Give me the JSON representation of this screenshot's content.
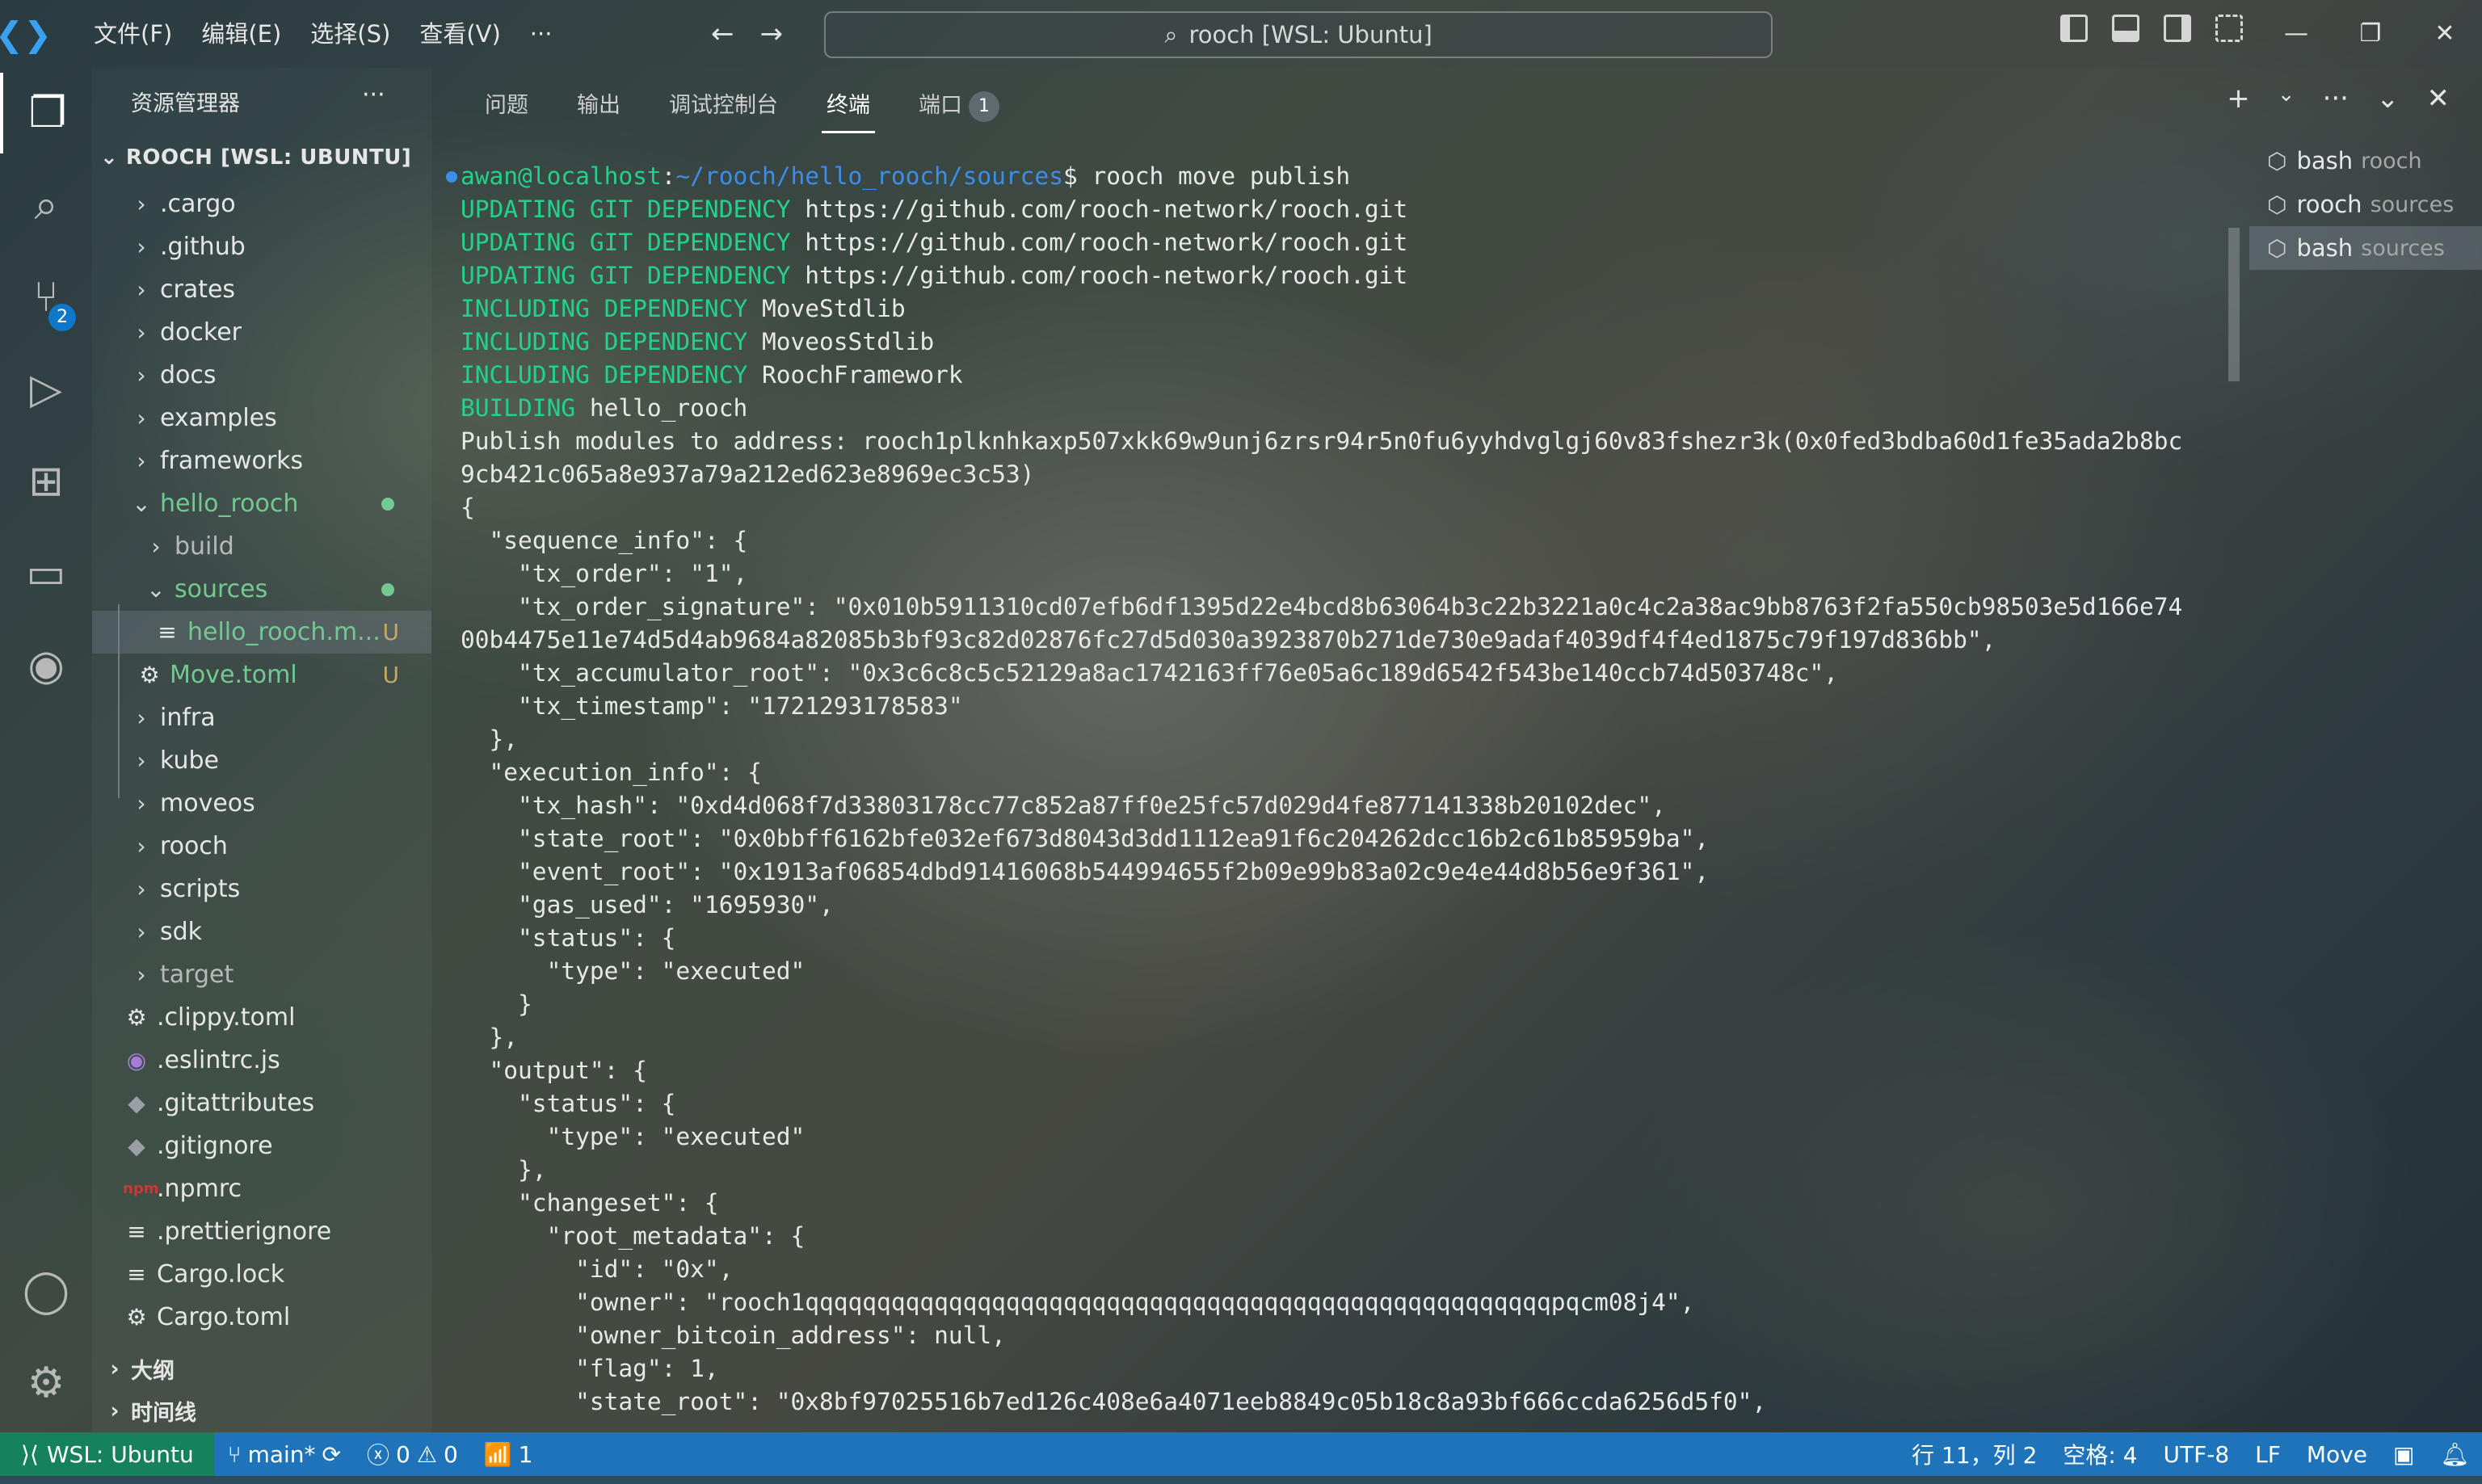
{
  "titlebar": {
    "menu": [
      "文件(F)",
      "编辑(E)",
      "选择(S)",
      "查看(V)",
      "···"
    ],
    "search_text": "rooch [WSL: Ubuntu]"
  },
  "activity_bar": {
    "scm_badge": "2"
  },
  "sidebar": {
    "title": "资源管理器",
    "more": "···",
    "root": "ROOCH [WSL: UBUNTU]",
    "items": [
      {
        "label": ".cargo",
        "type": "folder",
        "state": "collapsed"
      },
      {
        "label": ".github",
        "type": "folder",
        "state": "collapsed"
      },
      {
        "label": "crates",
        "type": "folder",
        "state": "collapsed"
      },
      {
        "label": "docker",
        "type": "folder",
        "state": "collapsed"
      },
      {
        "label": "docs",
        "type": "folder",
        "state": "collapsed"
      },
      {
        "label": "examples",
        "type": "folder",
        "state": "collapsed"
      },
      {
        "label": "frameworks",
        "type": "folder",
        "state": "collapsed"
      },
      {
        "label": "hello_rooch",
        "type": "folder",
        "state": "expanded"
      },
      {
        "label": "build",
        "type": "folder",
        "state": "collapsed"
      },
      {
        "label": "sources",
        "type": "folder",
        "state": "expanded"
      },
      {
        "label": "hello_rooch.m...",
        "type": "file",
        "status": "U"
      },
      {
        "label": "Move.toml",
        "type": "file",
        "status": "U"
      },
      {
        "label": "infra",
        "type": "folder",
        "state": "collapsed"
      },
      {
        "label": "kube",
        "type": "folder",
        "state": "collapsed"
      },
      {
        "label": "moveos",
        "type": "folder",
        "state": "collapsed"
      },
      {
        "label": "rooch",
        "type": "folder",
        "state": "collapsed"
      },
      {
        "label": "scripts",
        "type": "folder",
        "state": "collapsed"
      },
      {
        "label": "sdk",
        "type": "folder",
        "state": "collapsed"
      },
      {
        "label": "target",
        "type": "folder",
        "state": "collapsed"
      },
      {
        "label": ".clippy.toml",
        "type": "file"
      },
      {
        "label": ".eslintrc.js",
        "type": "file"
      },
      {
        "label": ".gitattributes",
        "type": "file"
      },
      {
        "label": ".gitignore",
        "type": "file"
      },
      {
        "label": ".npmrc",
        "type": "file"
      },
      {
        "label": ".prettierignore",
        "type": "file"
      },
      {
        "label": "Cargo.lock",
        "type": "file"
      },
      {
        "label": "Cargo.toml",
        "type": "file"
      }
    ],
    "outline": "大纲",
    "timeline": "时间线"
  },
  "panel": {
    "tabs": [
      "问题",
      "输出",
      "调试控制台",
      "终端",
      "端口"
    ],
    "ports_badge": "1",
    "terminals": [
      {
        "name": "bash",
        "cwd": "rooch"
      },
      {
        "name": "rooch",
        "cwd": "sources"
      },
      {
        "name": "bash",
        "cwd": "sources"
      }
    ]
  },
  "terminal": {
    "prompt_user": "awan@localhost",
    "prompt_path": "~/rooch/hello_rooch/sources",
    "command": "$ rooch move publish",
    "lines": [
      {
        "kw": "UPDATING GIT DEPENDENCY",
        "text": " https://github.com/rooch-network/rooch.git"
      },
      {
        "kw": "UPDATING GIT DEPENDENCY",
        "text": " https://github.com/rooch-network/rooch.git"
      },
      {
        "kw": "UPDATING GIT DEPENDENCY",
        "text": " https://github.com/rooch-network/rooch.git"
      },
      {
        "kw": "INCLUDING DEPENDENCY",
        "text": " MoveStdlib"
      },
      {
        "kw": "INCLUDING DEPENDENCY",
        "text": " MoveosStdlib"
      },
      {
        "kw": "INCLUDING DEPENDENCY",
        "text": " RoochFramework"
      },
      {
        "kw": "BUILDING",
        "text": " hello_rooch"
      },
      {
        "kw": "",
        "text": "Publish modules to address: rooch1plknhkaxp507xkk69w9unj6zrsr94r5n0fu6yyhdvglgj60v83fshezr3k(0x0fed3bdba60d1fe35ada2b8bc"
      },
      {
        "kw": "",
        "text": "9cb421c065a8e937a79a212ed623e8969ec3c53)"
      },
      {
        "kw": "",
        "text": "{"
      },
      {
        "kw": "",
        "text": "  \"sequence_info\": {"
      },
      {
        "kw": "",
        "text": "    \"tx_order\": \"1\","
      },
      {
        "kw": "",
        "text": "    \"tx_order_signature\": \"0x010b5911310cd07efb6df1395d22e4bcd8b63064b3c22b3221a0c4c2a38ac9bb8763f2fa550cb98503e5d166e74"
      },
      {
        "kw": "",
        "text": "00b4475e11e74d5d4ab9684a82085b3bf93c82d02876fc27d5d030a3923870b271de730e9adaf4039df4f4ed1875c79f197d836bb\","
      },
      {
        "kw": "",
        "text": "    \"tx_accumulator_root\": \"0x3c6c8c5c52129a8ac1742163ff76e05a6c189d6542f543be140ccb74d503748c\","
      },
      {
        "kw": "",
        "text": "    \"tx_timestamp\": \"1721293178583\""
      },
      {
        "kw": "",
        "text": "  },"
      },
      {
        "kw": "",
        "text": "  \"execution_info\": {"
      },
      {
        "kw": "",
        "text": "    \"tx_hash\": \"0xd4d068f7d33803178cc77c852a87ff0e25fc57d029d4fe877141338b20102dec\","
      },
      {
        "kw": "",
        "text": "    \"state_root\": \"0x0bbff6162bfe032ef673d8043d3dd1112ea91f6c204262dcc16b2c61b85959ba\","
      },
      {
        "kw": "",
        "text": "    \"event_root\": \"0x1913af06854dbd91416068b544994655f2b09e99b83a02c9e4e44d8b56e9f361\","
      },
      {
        "kw": "",
        "text": "    \"gas_used\": \"1695930\","
      },
      {
        "kw": "",
        "text": "    \"status\": {"
      },
      {
        "kw": "",
        "text": "      \"type\": \"executed\""
      },
      {
        "kw": "",
        "text": "    }"
      },
      {
        "kw": "",
        "text": "  },"
      },
      {
        "kw": "",
        "text": "  \"output\": {"
      },
      {
        "kw": "",
        "text": "    \"status\": {"
      },
      {
        "kw": "",
        "text": "      \"type\": \"executed\""
      },
      {
        "kw": "",
        "text": "    },"
      },
      {
        "kw": "",
        "text": "    \"changeset\": {"
      },
      {
        "kw": "",
        "text": "      \"root_metadata\": {"
      },
      {
        "kw": "",
        "text": "        \"id\": \"0x\","
      },
      {
        "kw": "",
        "text": "        \"owner\": \"rooch1qqqqqqqqqqqqqqqqqqqqqqqqqqqqqqqqqqqqqqqqqqqqqqqqqqqqpqcm08j4\","
      },
      {
        "kw": "",
        "text": "        \"owner_bitcoin_address\": null,"
      },
      {
        "kw": "",
        "text": "        \"flag\": 1,"
      },
      {
        "kw": "",
        "text": "        \"state_root\": \"0x8bf97025516b7ed126c408e6a4071eeb8849c05b18c8a93bf666ccda6256d5f0\","
      }
    ]
  },
  "statusbar": {
    "remote": "WSL: Ubuntu",
    "branch": "main*",
    "errors": "0",
    "warnings": "0",
    "ports": "1",
    "cursor": "行 11，列 2",
    "indent": "空格: 4",
    "encoding": "UTF-8",
    "eol": "LF",
    "language": "Move"
  },
  "colors": {
    "accent": "#1f74b9",
    "remote": "#16825d",
    "git_added": "#73c991",
    "untracked": "#c7a866",
    "term_green": "#23d18b",
    "term_blue": "#3b8eea"
  }
}
